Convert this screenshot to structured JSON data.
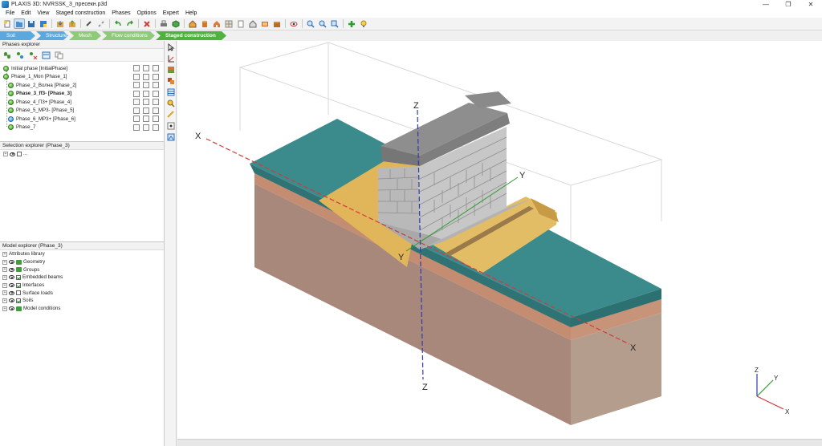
{
  "window": {
    "title": "PLAXIS 3D: NVRSSK_3_пресекн.p3d",
    "minimize": "—",
    "maximize": "❐",
    "close": "✕"
  },
  "menu": [
    "File",
    "Edit",
    "View",
    "Staged construction",
    "Phases",
    "Options",
    "Expert",
    "Help"
  ],
  "mode_tabs": [
    {
      "label": "Soil"
    },
    {
      "label": "Structures"
    },
    {
      "label": "Mesh"
    },
    {
      "label": "Flow conditions"
    },
    {
      "label": "Staged construction"
    }
  ],
  "phases_explorer": {
    "title": "Phases explorer",
    "phases": [
      {
        "label": "Initial phase [InitialPhase]",
        "status": "green",
        "bold": false
      },
      {
        "label": "Phase_1_Mon [Phase_1]",
        "status": "green",
        "bold": false
      },
      {
        "label": "Phase_2_Волна [Phase_2]",
        "status": "green",
        "bold": false
      },
      {
        "label": "Phase_3_ff3- [Phase_3]",
        "status": "green",
        "bold": true
      },
      {
        "label": "Phase_4_П3+ [Phase_4]",
        "status": "green",
        "bold": false
      },
      {
        "label": "Phase_5_МР3- [Phase_5]",
        "status": "green",
        "bold": false
      },
      {
        "label": "Phase_6_МР3+ [Phase_6]",
        "status": "blue",
        "bold": false
      },
      {
        "label": "Phase_7",
        "status": "green",
        "bold": false
      }
    ]
  },
  "selection_explorer": {
    "title": "Selection explorer (Phase_3)",
    "item": "..."
  },
  "model_explorer": {
    "title": "Model explorer (Phase_3)",
    "items": [
      {
        "label": "Attributes library",
        "eye": false,
        "check": "none"
      },
      {
        "label": "Geometry",
        "eye": true,
        "check": "folder"
      },
      {
        "label": "Groups",
        "eye": true,
        "check": "folder"
      },
      {
        "label": "Embedded beams",
        "eye": true,
        "check": "on"
      },
      {
        "label": "Interfaces",
        "eye": true,
        "check": "on"
      },
      {
        "label": "Surface loads",
        "eye": true,
        "check": "off"
      },
      {
        "label": "Soils",
        "eye": true,
        "check": "on"
      },
      {
        "label": "Model conditions",
        "eye": false,
        "check": "none"
      }
    ]
  },
  "viewport": {
    "axes": {
      "x": "X",
      "y": "Y",
      "z": "Z"
    },
    "colors": {
      "soil_top": "#3a8a8c",
      "soil_side": "#b39b8a",
      "soil_front": "#9f8677",
      "clay_strip": "#c08e72",
      "sand": "#e2b65c",
      "wall": "#b9b9b9",
      "wall_cap": "#8a8a8a",
      "x_axis": "#d23a3a",
      "z_axis": "#2f3ab0"
    }
  }
}
